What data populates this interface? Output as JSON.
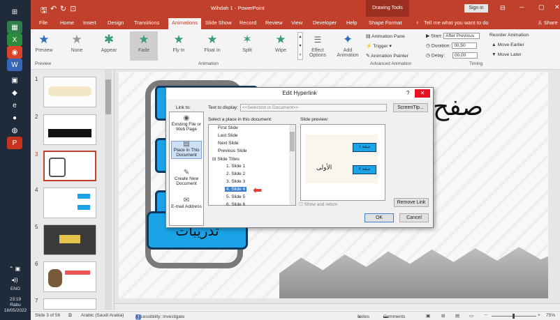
{
  "taskbar": {
    "time": "23:19",
    "day": "Rabu",
    "date": "18/05/2022",
    "lang": "ENG"
  },
  "titlebar": {
    "title": "Wihdah 1  -  PowerPoint",
    "context": "Drawing Tools",
    "signin": "Sign in"
  },
  "tabs": [
    "File",
    "Home",
    "Insert",
    "Design",
    "Transitions",
    "Animations",
    "Slide Show",
    "Record",
    "Review",
    "View",
    "Developer",
    "Help",
    "Shape Format"
  ],
  "tell": "Tell me what you want to do",
  "share": "Share",
  "ribbon": {
    "preview": "Preview",
    "animations": [
      "None",
      "Appear",
      "Fade",
      "Fly In",
      "Float In",
      "Split",
      "Wipe"
    ],
    "effect_options": "Effect Options",
    "add_animation": "Add Animation",
    "animation_pane": "Animation Pane",
    "trigger": "Trigger",
    "painter": "Animation Painter",
    "start_label": "Start:",
    "start_value": "After Previous",
    "duration_label": "Duration:",
    "duration_value": "00,50",
    "delay_label": "Delay:",
    "delay_value": "00,00",
    "reorder": "Reorder Animation",
    "earlier": "Move Earlier",
    "later": "Move Later",
    "groups": {
      "preview": "Preview",
      "animation": "Animation",
      "advanced": "Advanced Animation",
      "timing": "Timing"
    }
  },
  "thumbs": [
    "1",
    "2",
    "3",
    "4",
    "5",
    "6",
    "7"
  ],
  "dialog": {
    "title": "Edit Hyperlink",
    "help": "?",
    "close": "✕",
    "link_to": "Link to:",
    "text_to_display_label": "Text to display:",
    "text_to_display_value": "<<Selection in Document>>",
    "screentip": "ScreenTip...",
    "select_place": "Select a place in this document:",
    "slide_preview": "Slide preview:",
    "link_options": [
      "Existing File or Web Page",
      "Place in This Document",
      "Create New Document",
      "E-mail Address"
    ],
    "places": [
      "First Slide",
      "Last Slide",
      "Next Slide",
      "Previous Slide",
      "Slide Titles",
      "1. Slide 1",
      "2. Slide 2",
      "3. Slide 3",
      "4. Slide 4",
      "5. Slide 5",
      "6. Slide 6"
    ],
    "show_return": "Show and return",
    "remove_link": "Remove Link",
    "ok": "OK",
    "cancel": "Cancel",
    "preview_text": [
      "ميقة ١",
      "ميقة ٢",
      "الأولى"
    ]
  },
  "slide": {
    "arabic_big": "صفح",
    "arabic_box": "تدريبات"
  },
  "status": {
    "slide": "Slide 3 of 56",
    "lang": "Arabic (Saudi Arabia)",
    "access": "Accessibility: Investigate",
    "notes": "Notes",
    "comments": "Comments",
    "zoom": "75%"
  },
  "colors": {
    "accent": "#c0402b",
    "select": "#3d7fd1",
    "boxblue": "#1ba3e8"
  }
}
